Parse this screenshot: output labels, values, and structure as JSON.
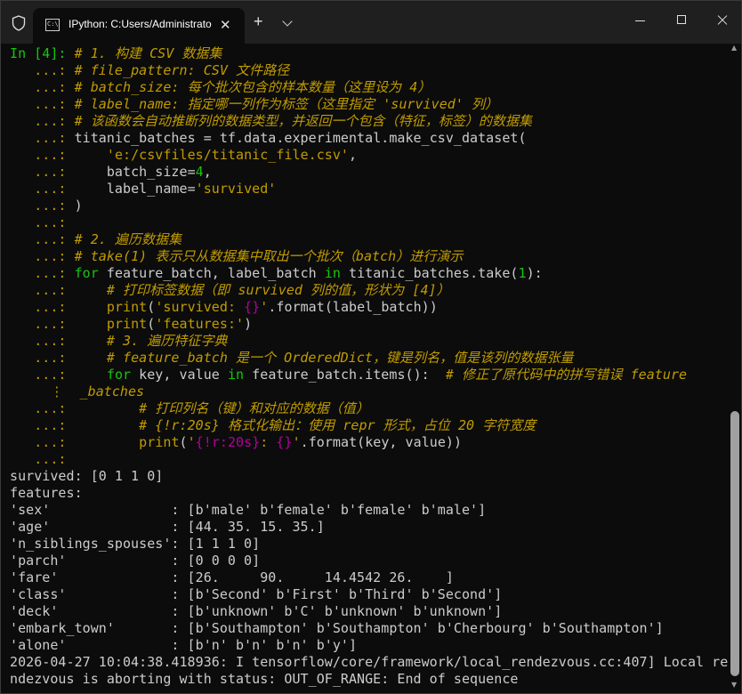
{
  "window": {
    "tab_title": "IPython: C:Users/Administrato",
    "tab_icon_text": "C:\\",
    "new_tab_label": "+",
    "tab_close_label": "✕"
  },
  "prompt": {
    "input": "In [4]:",
    "continuation": "   ...:",
    "wrap": "     ⋮ "
  },
  "code": {
    "l1": "# 1. 构建 CSV 数据集",
    "l2": "# file_pattern: CSV 文件路径",
    "l3": "# batch_size: 每个批次包含的样本数量（这里设为 4）",
    "l4": "# label_name: 指定哪一列作为标签（这里指定 'survived' 列）",
    "l5": "# 该函数会自动推断列的数据类型，并返回一个包含（特征，标签）的数据集",
    "l6a": "titanic_batches = tf.data.experimental.make_csv_dataset(",
    "l7a": "    ",
    "l7b": "'e:/csvfiles/titanic_file.csv'",
    "l7c": ",",
    "l8a": "    batch_size=",
    "l8b": "4",
    "l8c": ",",
    "l9a": "    label_name=",
    "l9b": "'survived'",
    "l10": ")",
    "l12": "# 2. 遍历数据集",
    "l13": "# take(1) 表示只从数据集中取出一个批次（batch）进行演示",
    "l14a": "for",
    "l14b": " feature_batch, label_batch ",
    "l14c": "in",
    "l14d": " titanic_batches.take(",
    "l14e": "1",
    "l14f": "):",
    "l15": "    # 打印标签数据（即 survived 列的值，形状为 [4]）",
    "l16a": "    ",
    "l16b": "print",
    "l16c": "(",
    "l16d": "'survived: ",
    "l16e": "{}",
    "l16f": "'",
    "l16g": ".format(label_batch))",
    "l17a": "    ",
    "l17b": "print",
    "l17c": "(",
    "l17d": "'features:'",
    "l17e": ")",
    "l18": "    # 3. 遍历特征字典",
    "l19": "    # feature_batch 是一个 OrderedDict，键是列名，值是该列的数据张量",
    "l20a": "    ",
    "l20b": "for",
    "l20c": " key, value ",
    "l20d": "in",
    "l20e": " feature_batch.items():  ",
    "l20f": "# 修正了原代码中的拼写错误 feature",
    "l21": "_batches",
    "l22": "        # 打印列名（键）和对应的数据（值）",
    "l23": "        # {!r:20s} 格式化输出：使用 repr 形式，占位 20 字符宽度",
    "l24a": "        ",
    "l24b": "print",
    "l24c": "(",
    "l24d": "'",
    "l24e": "{!r:20s}",
    "l24f": ": ",
    "l24g": "{}",
    "l24h": "'",
    "l24i": ".format(key, value))"
  },
  "output": {
    "o1": "survived: [0 1 1 0]",
    "o2": "features:",
    "o3": "'sex'               : [b'male' b'female' b'female' b'male']",
    "o4": "'age'               : [44. 35. 15. 35.]",
    "o5": "'n_siblings_spouses': [1 1 1 0]",
    "o6": "'parch'             : [0 0 0 0]",
    "o7": "'fare'              : [26.     90.     14.4542 26.    ]",
    "o8": "'class'             : [b'Second' b'First' b'Third' b'Second']",
    "o9": "'deck'              : [b'unknown' b'C' b'unknown' b'unknown']",
    "o10": "'embark_town'       : [b'Southampton' b'Southampton' b'Cherbourg' b'Southampton']",
    "o11": "'alone'             : [b'n' b'n' b'n' b'y']",
    "o12": "2026-04-27 10:04:38.418936: I tensorflow/core/framework/local_rendezvous.cc:407] Local re",
    "o13": "ndezvous is aborting with status: OUT_OF_RANGE: End of sequence"
  }
}
